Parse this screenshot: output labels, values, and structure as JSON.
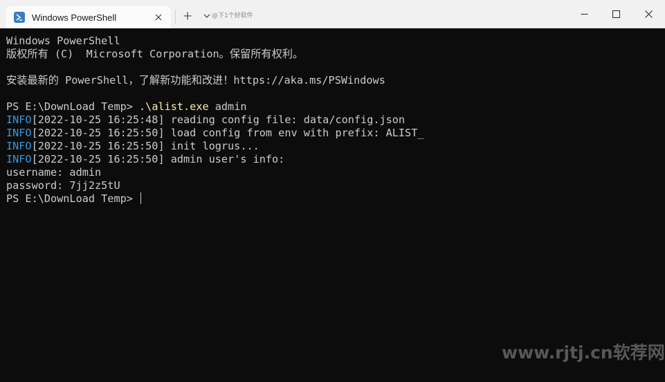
{
  "window": {
    "tab_title": "Windows PowerShell",
    "watermark_top": "@下1个好软件"
  },
  "icons": {
    "tab": "powershell-icon",
    "tab_close": "close-icon",
    "new_tab": "plus-icon",
    "dropdown": "chevron-down-icon",
    "minimize": "minimize-icon",
    "maximize": "maximize-icon",
    "close": "close-icon"
  },
  "terminal": {
    "l1": "Windows PowerShell",
    "l2": "版权所有 (C)  Microsoft Corporation。保留所有权利。",
    "l3": "",
    "l4": "安装最新的 PowerShell，了解新功能和改进！https://aka.ms/PSWindows",
    "l5": "",
    "prompt1": "PS E:\\DownLoad Temp> ",
    "cmd_exe": ".\\alist.exe",
    "cmd_arg": " admin",
    "log": [
      {
        "level": "INFO",
        "text": "[2022-10-25 16:25:48] reading config file: data/config.json"
      },
      {
        "level": "INFO",
        "text": "[2022-10-25 16:25:50] load config from env with prefix: ALIST_"
      },
      {
        "level": "INFO",
        "text": "[2022-10-25 16:25:50] init logrus..."
      },
      {
        "level": "INFO",
        "text": "[2022-10-25 16:25:50] admin user's info:"
      }
    ],
    "username_line": "username: admin",
    "password_line": "password: 7jj2z5tU",
    "prompt2": "PS E:\\DownLoad Temp> "
  },
  "watermark": "www.rjtj.cn软荐网",
  "colors": {
    "terminal_bg": "#0c0c0c",
    "text": "#cccccc",
    "info": "#3a96dd",
    "command": "#f9f1a5"
  }
}
